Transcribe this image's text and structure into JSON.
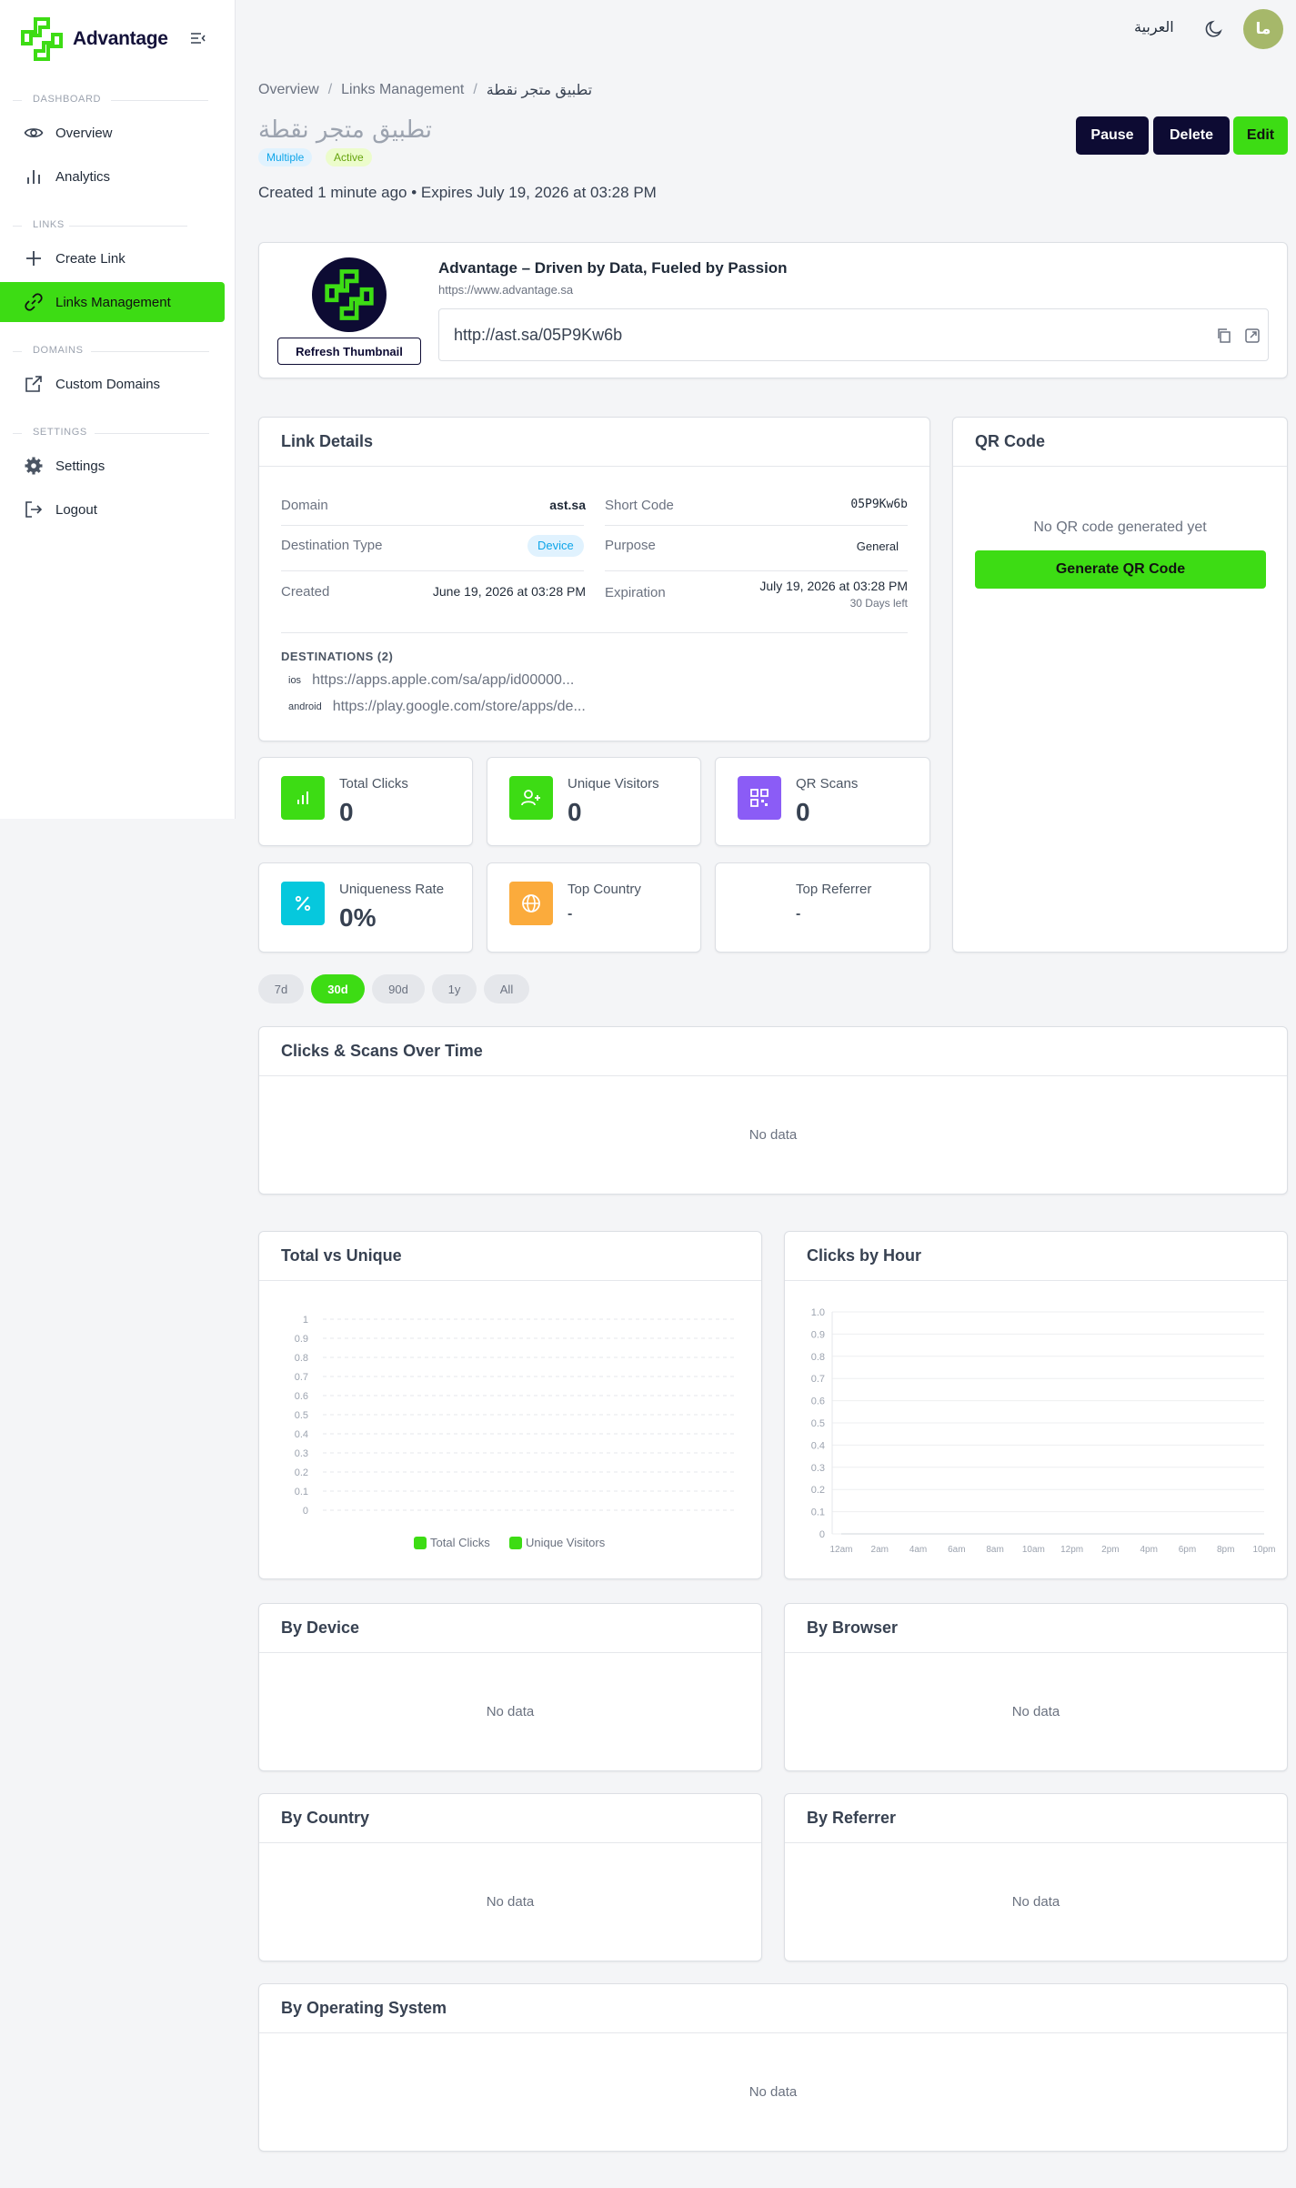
{
  "brand": {
    "name": "Advantage",
    "accent": "#3ddc14",
    "navy": "#0d0b33"
  },
  "topbar": {
    "language": "العربية",
    "avatar_initials": "ما"
  },
  "sidebar": {
    "sections": [
      {
        "label": "DASHBOARD",
        "items": [
          {
            "label": "Overview",
            "icon": "eye-icon"
          },
          {
            "label": "Analytics",
            "icon": "bar-chart-icon"
          }
        ]
      },
      {
        "label": "LINKS",
        "items": [
          {
            "label": "Create Link",
            "icon": "plus-icon"
          },
          {
            "label": "Links Management",
            "icon": "link-icon",
            "active": true
          }
        ]
      },
      {
        "label": "DOMAINS",
        "items": [
          {
            "label": "Custom Domains",
            "icon": "external-link-icon"
          }
        ]
      },
      {
        "label": "SETTINGS",
        "items": [
          {
            "label": "Settings",
            "icon": "gear-icon"
          },
          {
            "label": "Logout",
            "icon": "logout-icon"
          }
        ]
      }
    ]
  },
  "breadcrumb": {
    "items": [
      "Overview",
      "Links Management",
      "تطبيق متجر نقطة"
    ],
    "sep": "/"
  },
  "header": {
    "title": "تطبيق متجر نقطة",
    "badges": [
      "Multiple",
      "Active"
    ],
    "created_line": "Created 1 minute ago • Expires July 19, 2026 at 03:28 PM",
    "actions": {
      "pause": "Pause",
      "delete": "Delete",
      "edit": "Edit"
    }
  },
  "preview": {
    "refresh_label": "Refresh Thumbnail",
    "site_title": "Advantage – Driven by Data, Fueled by Passion",
    "site_url": "https://www.advantage.sa",
    "short_url": "http://ast.sa/05P9Kw6b"
  },
  "link_details": {
    "title": "Link Details",
    "domain": {
      "label": "Domain",
      "value": "ast.sa"
    },
    "short_code": {
      "label": "Short Code",
      "value": "05P9Kw6b"
    },
    "destination_type": {
      "label": "Destination Type",
      "value": "Device"
    },
    "purpose": {
      "label": "Purpose",
      "value": "General"
    },
    "created": {
      "label": "Created",
      "value": "June 19, 2026 at 03:28 PM"
    },
    "expiration": {
      "label": "Expiration",
      "value": "July 19, 2026 at 03:28 PM",
      "sub": "30 Days left"
    },
    "destinations_head": "DESTINATIONS (2)",
    "destinations": [
      {
        "tag": "ios",
        "url": "https://apps.apple.com/sa/app/id00000..."
      },
      {
        "tag": "android",
        "url": "https://play.google.com/store/apps/de..."
      }
    ]
  },
  "qr": {
    "title": "QR Code",
    "empty": "No QR code generated yet",
    "button": "Generate QR Code"
  },
  "stats": [
    {
      "label": "Total Clicks",
      "value": "0",
      "icon": "bar-chart-icon",
      "color": "#3ddc14"
    },
    {
      "label": "Unique Visitors",
      "value": "0",
      "icon": "user-plus-icon",
      "color": "#3ddc14"
    },
    {
      "label": "QR Scans",
      "value": "0",
      "icon": "qr-icon",
      "color": "#8b5cf6"
    },
    {
      "label": "Uniqueness Rate",
      "value": "0%",
      "icon": "percent-icon",
      "color": "#06c8dd"
    },
    {
      "label": "Top Country",
      "value": "-",
      "icon": "globe-icon",
      "color": "#fbab3c"
    },
    {
      "label": "Top Referrer",
      "value": "-",
      "icon": "",
      "color": ""
    }
  ],
  "ranges": {
    "items": [
      "7d",
      "30d",
      "90d",
      "1y",
      "All"
    ],
    "selected": "30d"
  },
  "panels": {
    "over_time": {
      "title": "Clicks & Scans Over Time",
      "empty": "No data"
    },
    "total_vs_unique": {
      "title": "Total vs Unique"
    },
    "clicks_by_hour": {
      "title": "Clicks by Hour"
    },
    "by_device": {
      "title": "By Device",
      "empty": "No data"
    },
    "by_browser": {
      "title": "By Browser",
      "empty": "No data"
    },
    "by_country": {
      "title": "By Country",
      "empty": "No data"
    },
    "by_referrer": {
      "title": "By Referrer",
      "empty": "No data"
    },
    "by_os": {
      "title": "By Operating System",
      "empty": "No data"
    }
  },
  "chart_data": [
    {
      "type": "bar",
      "title": "Total vs Unique",
      "categories": [],
      "series": [
        {
          "name": "Total Clicks",
          "values": []
        },
        {
          "name": "Unique Visitors",
          "values": []
        }
      ],
      "yticks": [
        "0",
        "0.1",
        "0.2",
        "0.3",
        "0.4",
        "0.5",
        "0.6",
        "0.7",
        "0.8",
        "0.9",
        "1"
      ],
      "ylim": [
        0,
        1
      ],
      "grid": true,
      "legend": "bottom"
    },
    {
      "type": "line",
      "title": "Clicks by Hour",
      "x": [
        "12am",
        "2am",
        "4am",
        "6am",
        "8am",
        "10am",
        "12pm",
        "2pm",
        "4pm",
        "6pm",
        "8pm",
        "10pm"
      ],
      "series": [
        {
          "values": [
            0,
            0,
            0,
            0,
            0,
            0,
            0,
            0,
            0,
            0,
            0,
            0
          ]
        }
      ],
      "yticks": [
        "0",
        "0.1",
        "0.2",
        "0.3",
        "0.4",
        "0.5",
        "0.6",
        "0.7",
        "0.8",
        "0.9",
        "1.0"
      ],
      "ylim": [
        0,
        1
      ],
      "grid": true
    }
  ]
}
